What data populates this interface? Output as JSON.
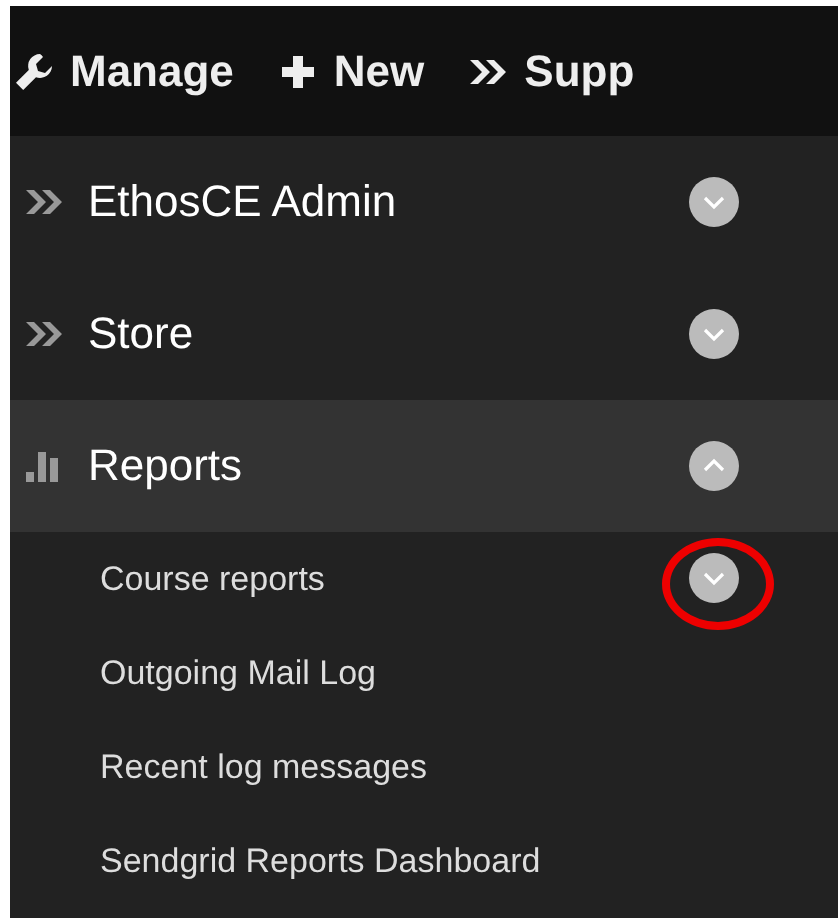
{
  "toolbar": [
    {
      "label": "Manage"
    },
    {
      "label": "New"
    },
    {
      "label": "Supp"
    }
  ],
  "menu": [
    {
      "kind": "link",
      "label": "EthosCE Admin",
      "expanded": false
    },
    {
      "kind": "link",
      "label": "Store",
      "expanded": false
    },
    {
      "kind": "report",
      "label": "Reports",
      "expanded": true,
      "children": [
        {
          "label": "Course reports",
          "has_toggle": true,
          "annotated": true
        },
        {
          "label": "Outgoing Mail Log",
          "has_toggle": false,
          "annotated": false
        },
        {
          "label": "Recent log messages",
          "has_toggle": false,
          "annotated": false
        },
        {
          "label": "Sendgrid Reports Dashboard",
          "has_toggle": false,
          "annotated": false
        }
      ]
    }
  ]
}
